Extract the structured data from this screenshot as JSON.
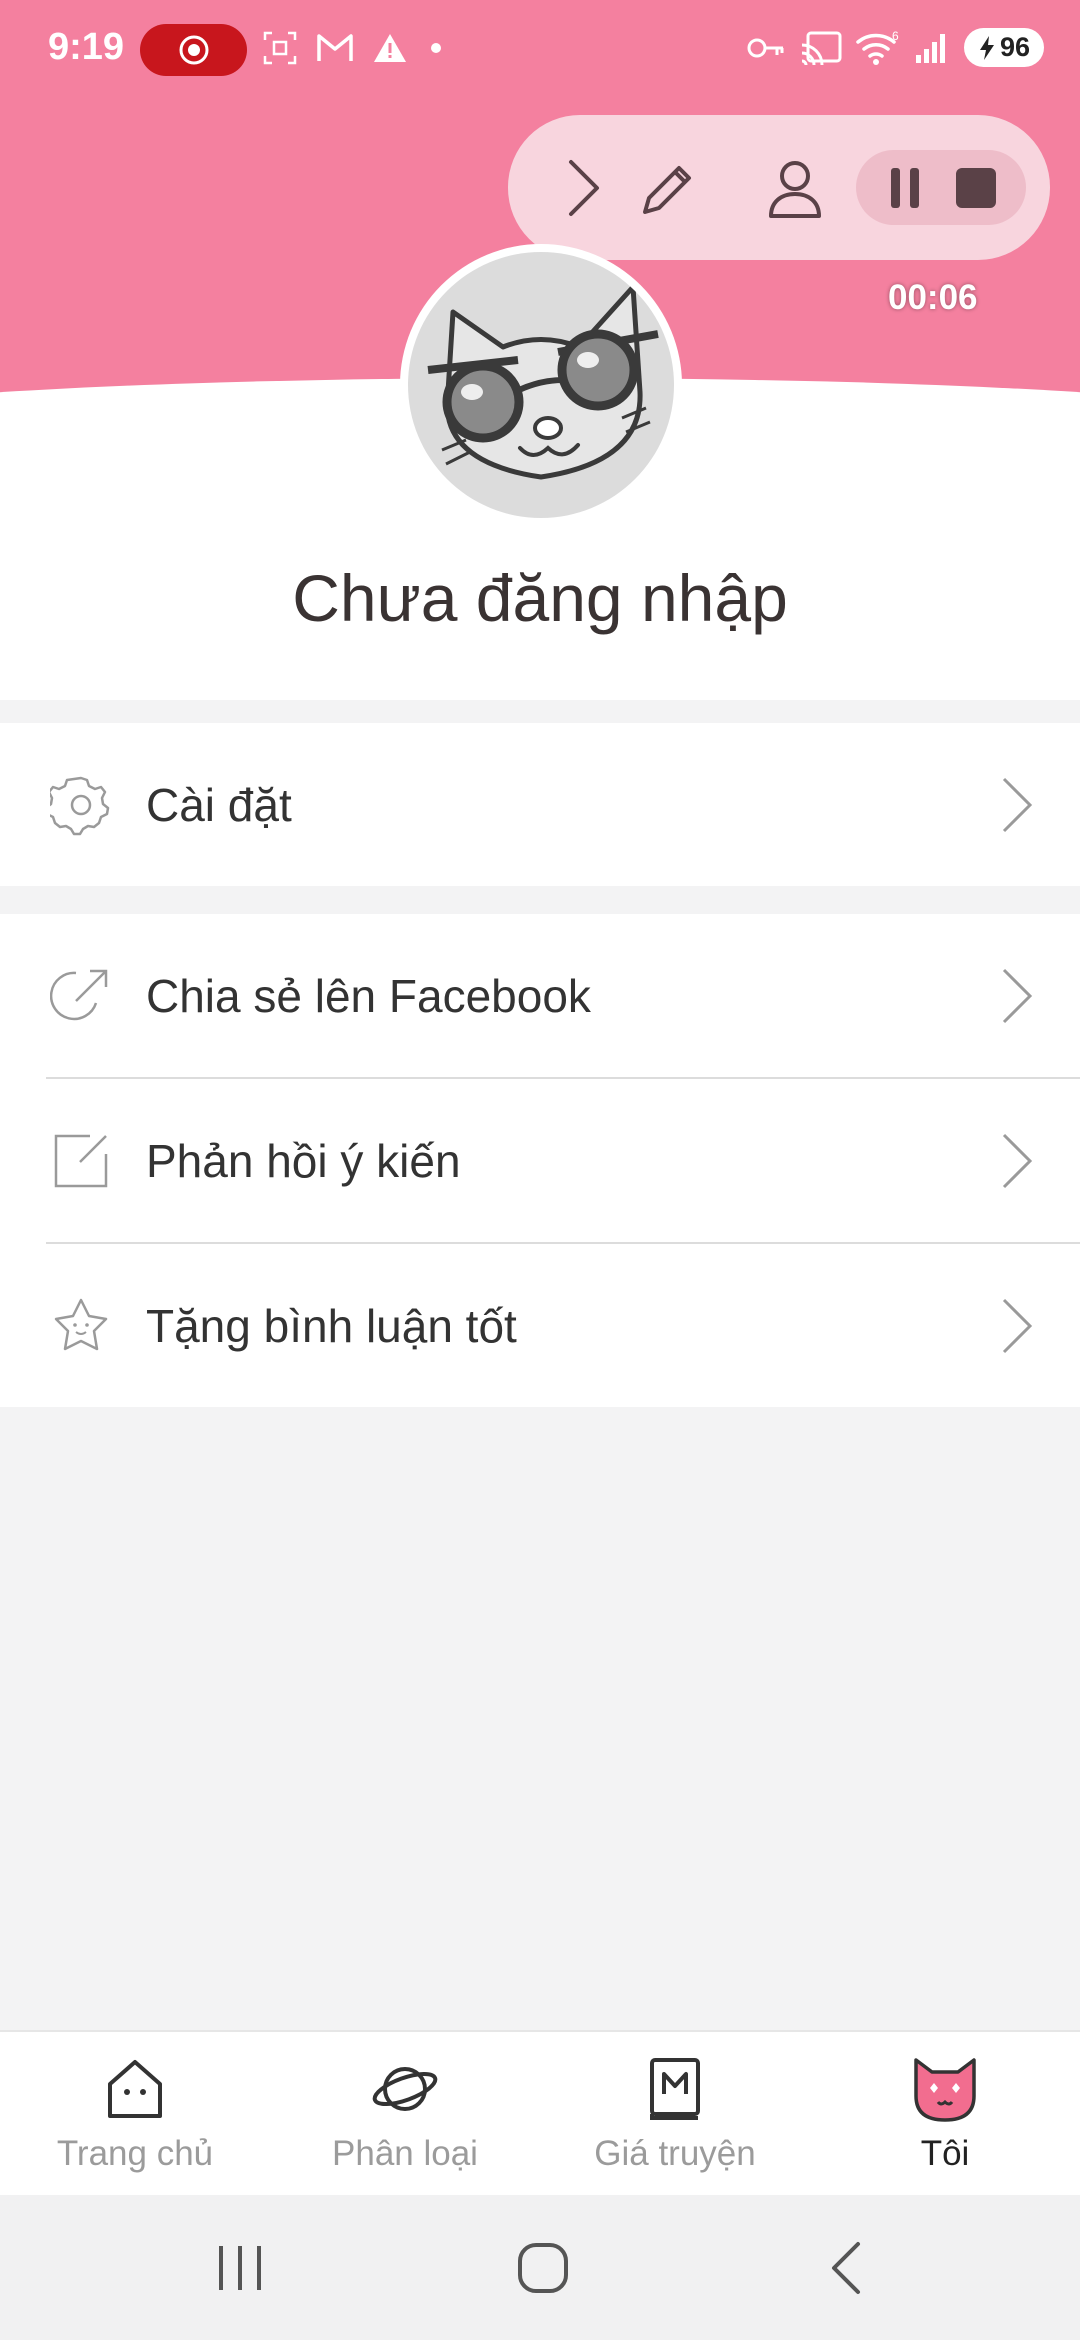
{
  "status_bar": {
    "time": "9:19",
    "battery": "96",
    "signal_badge": "6"
  },
  "recorder": {
    "timer": "00:06"
  },
  "profile": {
    "title": "Chưa đăng nhập"
  },
  "menu": {
    "settings": "Cài đặt",
    "share_facebook": "Chia sẻ lên Facebook",
    "feedback": "Phản hồi ý kiến",
    "rate": "Tặng bình luận tốt"
  },
  "bottom_nav": {
    "items": [
      {
        "label": "Trang chủ",
        "icon": "home-icon"
      },
      {
        "label": "Phân loại",
        "icon": "planet-icon"
      },
      {
        "label": "Giá truyện",
        "icon": "book-icon"
      },
      {
        "label": "Tôi",
        "icon": "cat-face-icon"
      }
    ],
    "active_index": 3
  },
  "colors": {
    "header_pink": "#f4809f",
    "record_red": "#c8161d",
    "toolbar_bg": "#f8d5de"
  }
}
